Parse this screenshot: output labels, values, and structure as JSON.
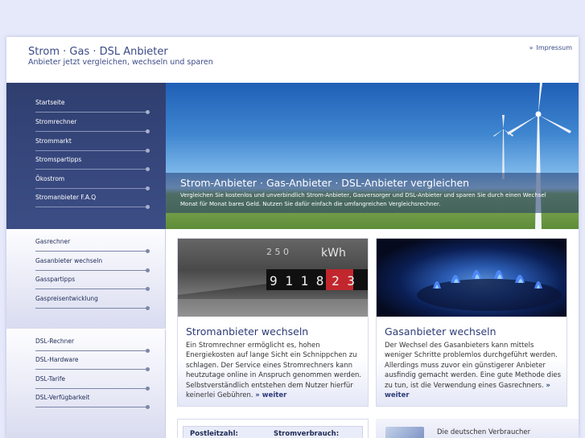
{
  "header": {
    "title": "Strom · Gas · DSL Anbieter",
    "subtitle": "Anbieter jetzt vergleichen, wechseln und sparen",
    "impressum": "Impressum",
    "impressum_bullet": "»"
  },
  "nav_strom": [
    {
      "label": "Startseite"
    },
    {
      "label": "Stromrechner"
    },
    {
      "label": "Strommarkt"
    },
    {
      "label": "Stromspartipps"
    },
    {
      "label": "Ökostrom"
    },
    {
      "label": "Stromanbieter F.A.Q"
    }
  ],
  "nav_gas": [
    {
      "label": "Gasrechner"
    },
    {
      "label": "Gasanbieter wechseln"
    },
    {
      "label": "Gasspartipps"
    },
    {
      "label": "Gaspreisentwicklung"
    }
  ],
  "nav_dsl": [
    {
      "label": "DSL-Rechner"
    },
    {
      "label": "DSL-Hardware"
    },
    {
      "label": "DSL-Tarife"
    },
    {
      "label": "DSL-Verfügbarkeit"
    }
  ],
  "hero": {
    "title": "Strom-Anbieter · Gas-Anbieter · DSL-Anbieter vergleichen",
    "text": "Vergleichen Sie kostenlos und unverbindlich Strom-Anbieter, Gasversorger und DSL-Anbieter und sparen Sie durch einen Wechsel Monat für Monat bares Geld. Nutzen Sie dafür einfach die umfangreichen Vergleichsrechner."
  },
  "cards": [
    {
      "title": "Stromanbieter wechseln",
      "text": "Ein Stromrechner ermöglicht es, hohen Energiekosten auf lange Sicht ein Schnippchen zu schlagen. Der Service eines Stromrechners kann heutzutage online in Anspruch genommen werden. Selbstverständlich entstehen dem Nutzer hierfür keinerlei Gebühren.",
      "more": "» weiter",
      "meter_top": "2 5 0",
      "meter_unit": "kWh",
      "meter_digits": "9 1 1 8 2 3"
    },
    {
      "title": "Gasanbieter wechseln",
      "text": "Der Wechsel des Gasanbieters kann mittels weniger Schritte problemlos durchgeführt werden. Allerdings muss zuvor ein günstigerer Anbieter ausfindig gemacht werden. Eine gute Methode dies zu tun, ist die Verwendung eines Gasrechners.",
      "more": "» weiter"
    }
  ],
  "calculator": {
    "postleitzahl_label": "Postleitzahl:",
    "verbrauch_label": "Stromverbrauch:"
  },
  "bottom_teaser": {
    "text": "Die deutschen Verbraucher"
  },
  "colors": {
    "page_bg": "#e6e9fa",
    "nav_dark": "#35457a",
    "accent_text": "#2d3c78"
  }
}
